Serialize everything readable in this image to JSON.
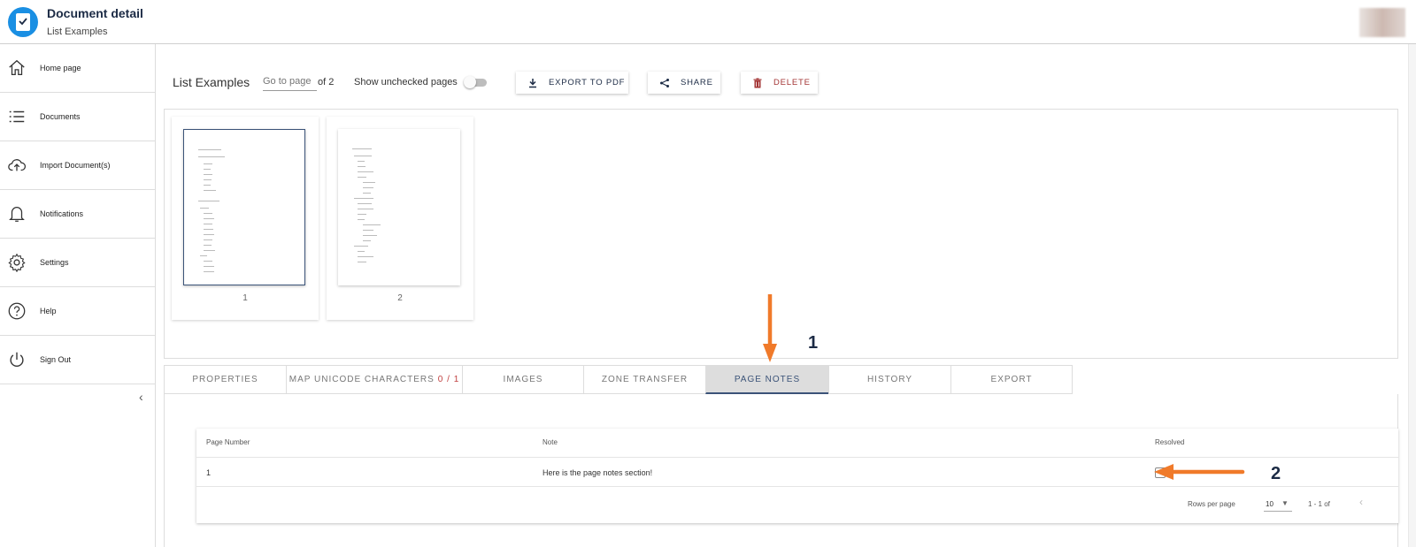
{
  "header": {
    "title": "Document detail",
    "subtitle": "List Examples"
  },
  "sidebar": {
    "items": [
      {
        "label": "Home page",
        "icon": "home-icon"
      },
      {
        "label": "Documents",
        "icon": "list-icon"
      },
      {
        "label": "Import Document(s)",
        "icon": "cloud-upload-icon"
      },
      {
        "label": "Notifications",
        "icon": "bell-icon"
      },
      {
        "label": "Settings",
        "icon": "gear-icon"
      },
      {
        "label": "Help",
        "icon": "help-icon"
      },
      {
        "label": "Sign Out",
        "icon": "power-icon"
      }
    ],
    "collapse_glyph": "‹"
  },
  "toolbar": {
    "doc_title": "List Examples",
    "goto_placeholder": "Go to page",
    "of_pages": "of 2",
    "show_unchecked": "Show unchecked pages",
    "show_unchecked_on": false,
    "export_label": "EXPORT TO PDF",
    "share_label": "SHARE",
    "delete_label": "DELETE"
  },
  "thumbnails": [
    {
      "page": "1",
      "selected": true
    },
    {
      "page": "2",
      "selected": false
    }
  ],
  "annotations": {
    "step1": "1",
    "step2": "2",
    "arrow_color": "#f07a2a"
  },
  "tabs": [
    {
      "label": "PROPERTIES",
      "count": ""
    },
    {
      "label": "MAP UNICODE CHARACTERS",
      "count": "0 / 1"
    },
    {
      "label": "IMAGES",
      "count": ""
    },
    {
      "label": "ZONE TRANSFER",
      "count": ""
    },
    {
      "label": "PAGE NOTES",
      "count": "",
      "active": true
    },
    {
      "label": "HISTORY",
      "count": ""
    },
    {
      "label": "EXPORT",
      "count": ""
    }
  ],
  "notes_table": {
    "columns": [
      "Page Number",
      "Note",
      "Resolved"
    ],
    "rows": [
      {
        "page_number": "1",
        "note": "Here is the page notes section!",
        "resolved": false
      }
    ],
    "rows_per_page_label": "Rows per page",
    "rows_per_page": "10",
    "range": "1 - 1 of",
    "prev_glyph": "‹"
  },
  "colors": {
    "brand": "#1a8fe3",
    "navy": "#1c2b45",
    "active_tab": "#3b5378",
    "delete": "#a33434",
    "count": "#c04040"
  }
}
